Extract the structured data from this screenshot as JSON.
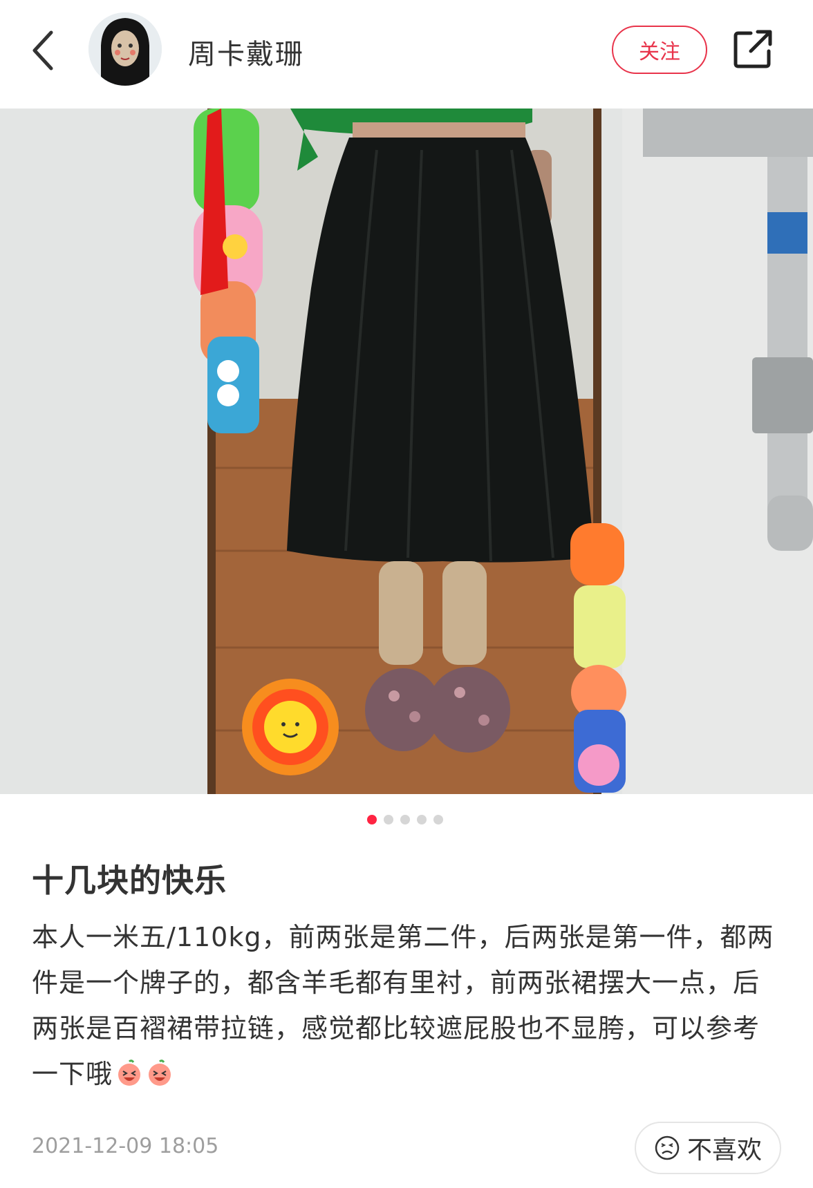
{
  "header": {
    "username": "周卡戴珊",
    "follow_label": "关注"
  },
  "post": {
    "image_count": 5,
    "active_image_index": 0,
    "title": "十几块的快乐",
    "body": "本人一米五/110kg，前两张是第二件，后两张是第一件，都两件是一个牌子的，都含羊毛都有里衬，前两张裙摆大一点，后两张是百褶裙带拉链，感觉都比较遮屁股也不显胯，可以参考一下哦",
    "timestamp": "2021-12-09 18:05"
  },
  "footer": {
    "dislike_label": "不喜欢"
  },
  "colors": {
    "accent": "#ff2442",
    "follow_border": "#e8334a",
    "muted_text": "#9e9e9e"
  },
  "icons": {
    "back": "chevron-left-icon",
    "share": "share-icon",
    "dislike": "frown-face-icon",
    "emoji": "laughing-face-emoji"
  }
}
